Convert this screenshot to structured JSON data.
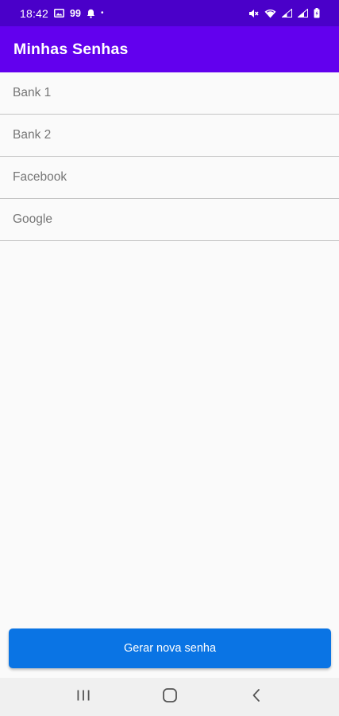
{
  "status_bar": {
    "time": "18:42",
    "badge": "99",
    "dot": "•",
    "icons": [
      "image-icon",
      "bell-icon",
      "mute-icon",
      "wifi-icon",
      "signal-icon",
      "signal-icon-2",
      "battery-icon"
    ]
  },
  "app_bar": {
    "title": "Minhas Senhas",
    "color": "#6200ee"
  },
  "list": {
    "items": [
      {
        "label": "Bank 1"
      },
      {
        "label": "Bank 2"
      },
      {
        "label": "Facebook"
      },
      {
        "label": "Google"
      }
    ]
  },
  "primary_button": {
    "label": "Gerar nova senha",
    "color": "#0a74e4"
  },
  "nav_bar": {
    "icons": [
      "recents-icon",
      "home-icon",
      "back-icon"
    ]
  }
}
